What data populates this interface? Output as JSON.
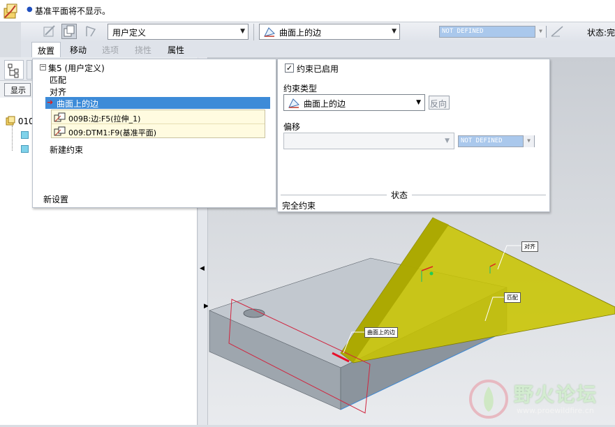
{
  "message": {
    "text": "基准平面将不显示。"
  },
  "toolbar": {
    "set_select": "用户定义",
    "constraint_select": "曲面上的边",
    "offset_value": "NOT DEFINED",
    "status": "状态:完"
  },
  "tabs": [
    {
      "label": "放置",
      "active": true
    },
    {
      "label": "移动",
      "active": false
    },
    {
      "label": "选项",
      "disabled": true
    },
    {
      "label": "挠性",
      "disabled": true
    },
    {
      "label": "属性",
      "active": false
    }
  ],
  "model_tree": {
    "show_button": "显示",
    "root_label": "010"
  },
  "placement_panel": {
    "set_header": "集5 (用户定义)",
    "items": [
      "匹配",
      "对齐"
    ],
    "selected_item": "曲面上的边",
    "references": [
      "009B:边:F5(拉伸_1)",
      "009:DTM1:F9(基准平面)"
    ],
    "new_constraint": "新建约束",
    "new_set": "新设置"
  },
  "constraint_panel": {
    "enabled_label": "约束已启用",
    "enabled": true,
    "type_heading": "约束类型",
    "type_value": "曲面上的边",
    "flip_button": "反向",
    "offset_heading": "偏移",
    "offset_value": "NOT DEFINED",
    "status_heading": "状态",
    "status_value": "完全约束"
  },
  "viewport_labels": {
    "align": "对齐",
    "match": "匹配",
    "edge_on_surface": "曲面上的边"
  },
  "watermark": {
    "title": "野火论坛",
    "url": "www.proewildfire.cn"
  },
  "colors": {
    "selection_blue": "#3d8bd8",
    "datum_plane_yellow": "#c8c400",
    "part_gray": "#9aa3ac",
    "offset_field_blue": "#aac8ec"
  }
}
